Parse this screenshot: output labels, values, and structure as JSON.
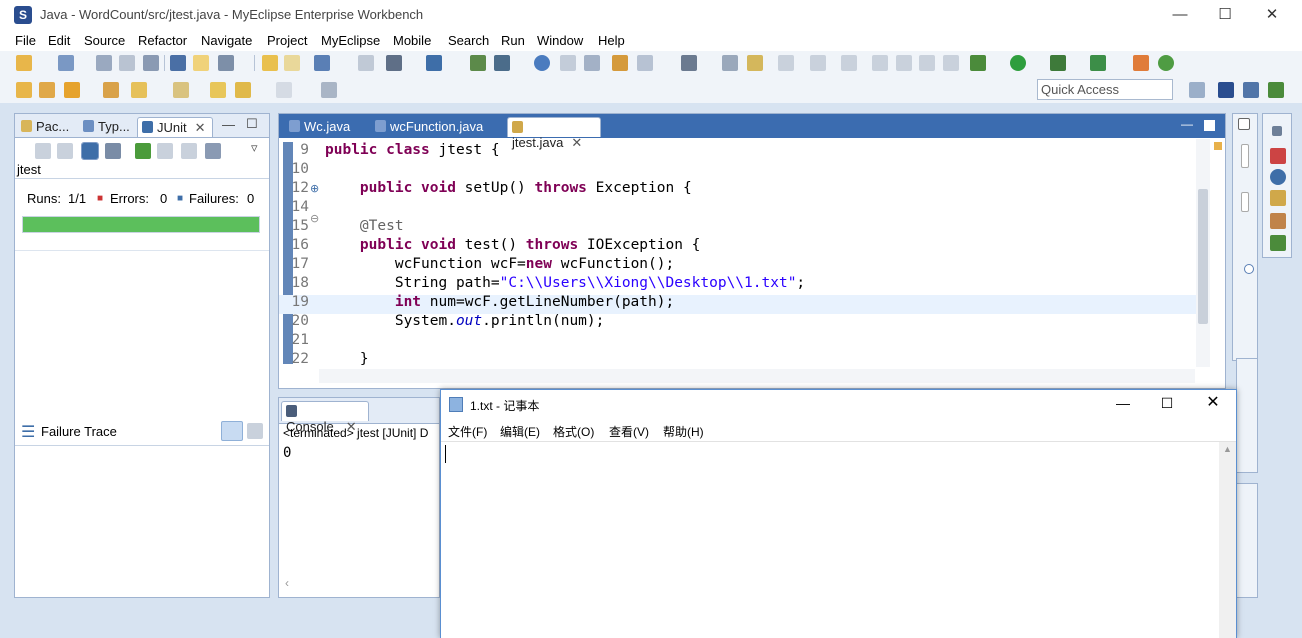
{
  "window": {
    "title": "Java - WordCount/src/jtest.java - MyEclipse Enterprise Workbench"
  },
  "menu": [
    "File",
    "Edit",
    "Source",
    "Refactor",
    "Navigate",
    "Project",
    "MyEclipse",
    "Mobile",
    "Search",
    "Run",
    "Window",
    "Help"
  ],
  "quick_access": "Quick Access",
  "left_tabs": [
    "Pac...",
    "Typ...",
    "JUnit"
  ],
  "junit": {
    "test_name": "jtest",
    "runs_label": "Runs:",
    "runs_value": "1/1",
    "errors_label": "Errors:",
    "errors_value": "0",
    "failures_label": "Failures:",
    "failures_value": "0",
    "progress": 1.0,
    "progress_color": "#5cbf5c",
    "failure_trace": "Failure Trace"
  },
  "editor_tabs": [
    "Wc.java",
    "wcFunction.java",
    "jtest.java"
  ],
  "code_lines": [
    {
      "n": "9",
      "html": "<span class='kw'>public class</span> jtest {"
    },
    {
      "n": "10",
      "html": ""
    },
    {
      "n": "12",
      "html": "    <span class='kw'>public void</span> setUp() <span class='kw'>throws</span> Exception {"
    },
    {
      "n": "14",
      "html": ""
    },
    {
      "n": "15",
      "html": "    <span class='ann'>@Test</span>"
    },
    {
      "n": "16",
      "html": "    <span class='kw'>public void</span> test() <span class='kw'>throws</span> IOException {"
    },
    {
      "n": "17",
      "html": "        wcFunction wcF=<span class='kw'>new</span> wcFunction();"
    },
    {
      "n": "18",
      "html": "        String path=<span class='str'>\"C:\\\\Users\\\\Xiong\\\\Desktop\\\\1.txt\"</span>;"
    },
    {
      "n": "19",
      "html": "        <span class='kw'>int</span> num=wcF.getLineNumber(path);"
    },
    {
      "n": "20",
      "html": "        System.<span class='fld'>out</span>.println(num);"
    },
    {
      "n": "21",
      "html": ""
    },
    {
      "n": "22",
      "html": "    }"
    }
  ],
  "console": {
    "tab": "Console",
    "status": "<terminated> jtest [JUnit] D",
    "output": "0"
  },
  "notepad": {
    "title": "1.txt - 记事本",
    "menu": [
      "文件(F)",
      "编辑(E)",
      "格式(O)",
      "查看(V)",
      "帮助(H)"
    ]
  }
}
